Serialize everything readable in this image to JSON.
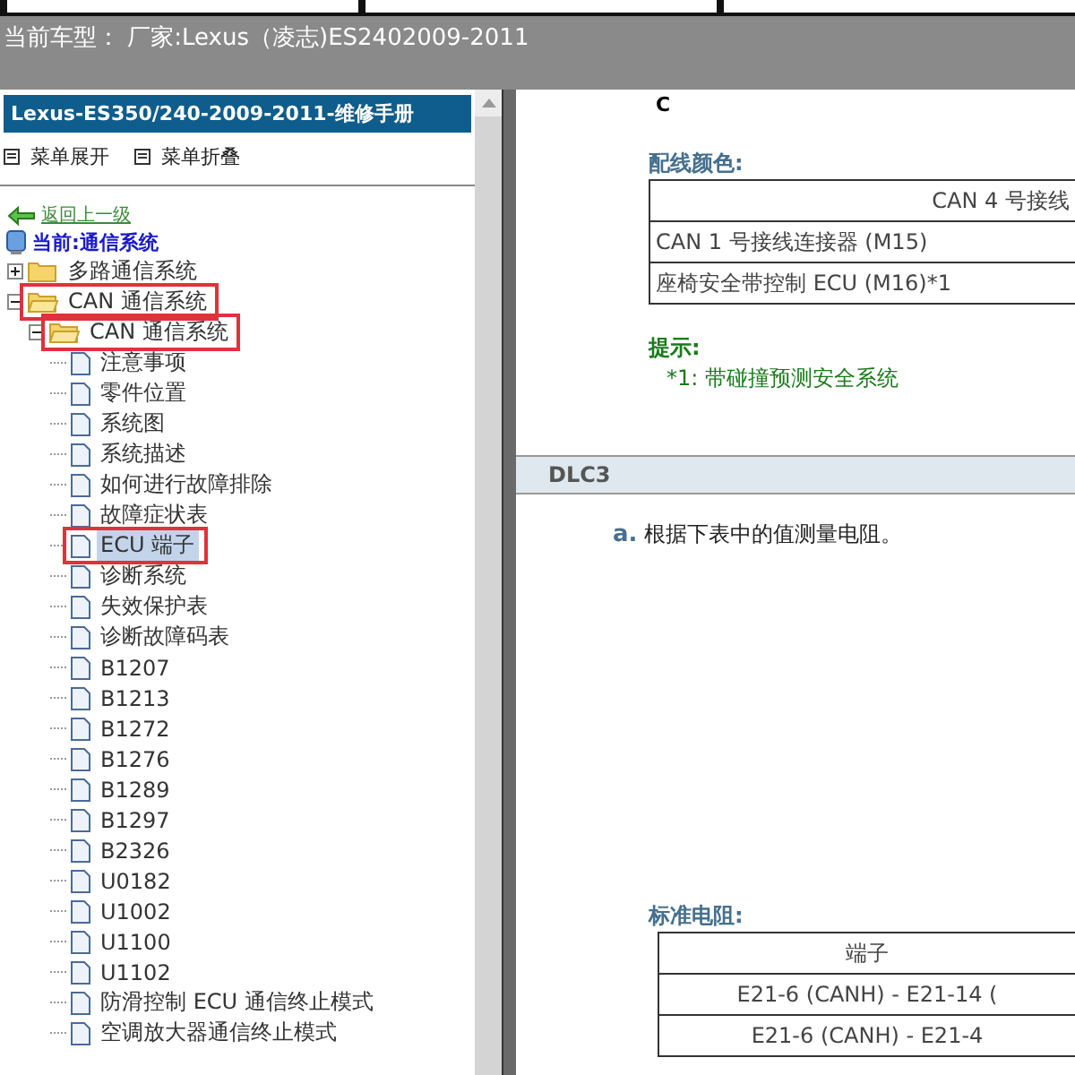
{
  "header": {
    "vehicle": "当前车型： 厂家:Lexus（凌志)ES2402009-2011"
  },
  "sidebar": {
    "title": "Lexus-ES350/240-2009-2011-维修手册",
    "toolbar": [
      "菜单展开",
      "菜单折叠"
    ],
    "back_link": "返回上一级",
    "current": "当前:通信系统",
    "tree": [
      {
        "label": "多路通信系统",
        "kind": "folder",
        "expanded": false,
        "annotated": false,
        "selected": false
      },
      {
        "label": "CAN 通信系统",
        "kind": "folder",
        "expanded": true,
        "annotated": true,
        "selected": false,
        "children": [
          {
            "label": "CAN 通信系统",
            "kind": "folder",
            "expanded": true,
            "annotated": true,
            "selected": false,
            "children": [
              {
                "label": "注意事项",
                "kind": "page",
                "selected": false,
                "annotated": false
              },
              {
                "label": "零件位置",
                "kind": "page",
                "selected": false,
                "annotated": false
              },
              {
                "label": "系统图",
                "kind": "page",
                "selected": false,
                "annotated": false
              },
              {
                "label": "系统描述",
                "kind": "page",
                "selected": false,
                "annotated": false
              },
              {
                "label": "如何进行故障排除",
                "kind": "page",
                "selected": false,
                "annotated": false
              },
              {
                "label": "故障症状表",
                "kind": "page",
                "selected": false,
                "annotated": false
              },
              {
                "label": "ECU 端子",
                "kind": "page",
                "selected": true,
                "annotated": true
              },
              {
                "label": "诊断系统",
                "kind": "page",
                "selected": false,
                "annotated": false
              },
              {
                "label": "失效保护表",
                "kind": "page",
                "selected": false,
                "annotated": false
              },
              {
                "label": "诊断故障码表",
                "kind": "page",
                "selected": false,
                "annotated": false
              },
              {
                "label": "B1207",
                "kind": "page",
                "selected": false,
                "annotated": false
              },
              {
                "label": "B1213",
                "kind": "page",
                "selected": false,
                "annotated": false
              },
              {
                "label": "B1272",
                "kind": "page",
                "selected": false,
                "annotated": false
              },
              {
                "label": "B1276",
                "kind": "page",
                "selected": false,
                "annotated": false
              },
              {
                "label": "B1289",
                "kind": "page",
                "selected": false,
                "annotated": false
              },
              {
                "label": "B1297",
                "kind": "page",
                "selected": false,
                "annotated": false
              },
              {
                "label": "B2326",
                "kind": "page",
                "selected": false,
                "annotated": false
              },
              {
                "label": "U0182",
                "kind": "page",
                "selected": false,
                "annotated": false
              },
              {
                "label": "U1002",
                "kind": "page",
                "selected": false,
                "annotated": false
              },
              {
                "label": "U1100",
                "kind": "page",
                "selected": false,
                "annotated": false
              },
              {
                "label": "U1102",
                "kind": "page",
                "selected": false,
                "annotated": false
              },
              {
                "label": "防滑控制 ECU 通信终止模式",
                "kind": "page",
                "selected": false,
                "annotated": false
              },
              {
                "label": "空调放大器通信终止模式",
                "kind": "page",
                "selected": false,
                "annotated": false
              }
            ]
          }
        ]
      }
    ]
  },
  "content": {
    "fragment": "C",
    "wiring_title": "配线颜色:",
    "wiring_table": {
      "header": "CAN 4 号接线",
      "rows": [
        "CAN 1 号接线连接器 (M15)",
        "座椅安全带控制 ECU (M16)*1"
      ]
    },
    "hint_title": "提示:",
    "hint_text": "*1: 带碰撞预测安全系统",
    "section": "DLC3",
    "step_marker": "a.",
    "step_text": "根据下表中的值测量电阻。",
    "resistance_title": "标准电阻:",
    "resistance_table": {
      "header": "端子",
      "rows": [
        "E21-6 (CANH) - E21-14 (",
        "E21-6 (CANH) - E21-4"
      ]
    }
  }
}
